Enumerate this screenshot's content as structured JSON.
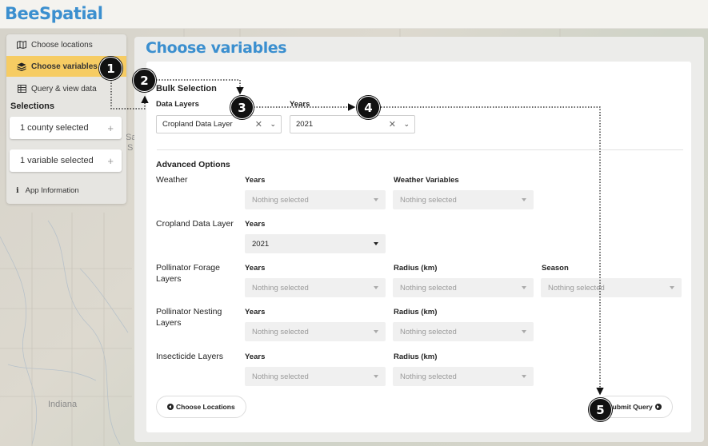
{
  "brand": "BeeSpatial",
  "map": {
    "labels": [
      "Indiana",
      "Sa",
      "S"
    ]
  },
  "sidebar": {
    "items": [
      {
        "label": "Choose locations",
        "icon": "map-icon"
      },
      {
        "label": "Choose variables",
        "icon": "layers-icon"
      },
      {
        "label": "Query & view data",
        "icon": "table-icon"
      }
    ],
    "selections_title": "Selections",
    "county_selected": "1 county selected",
    "variable_selected": "1 variable selected",
    "plus": "+",
    "app_info": "App Information",
    "app_info_icon_glyph": "i"
  },
  "main": {
    "title": "Choose variables",
    "bulk": {
      "heading": "Bulk Selection",
      "data_layers_label": "Data Layers",
      "data_layers_value": "Cropland Data Layer",
      "years_label": "Years",
      "years_value": "2021"
    },
    "advanced": {
      "heading": "Advanced Options",
      "placeholder": "Nothing selected",
      "rows": [
        {
          "label": "Weather",
          "col1": "Years",
          "col2": "Weather Variables"
        },
        {
          "label": "Cropland Data Layer",
          "col1": "Years",
          "col1_value": "2021"
        },
        {
          "label": "Pollinator Forage Layers",
          "col1": "Years",
          "col2": "Radius (km)",
          "col3": "Season"
        },
        {
          "label": "Pollinator Nesting Layers",
          "col1": "Years",
          "col2": "Radius (km)"
        },
        {
          "label": "Insecticide Layers",
          "col1": "Years",
          "col2": "Radius (km)"
        }
      ]
    },
    "choose_locations_button": "Choose Locations",
    "submit_button": "Submit Query"
  },
  "callouts": [
    "1",
    "2",
    "3",
    "4",
    "5"
  ],
  "colors": {
    "brand": "#3b8fcf",
    "active_nav": "#f6cc63"
  }
}
